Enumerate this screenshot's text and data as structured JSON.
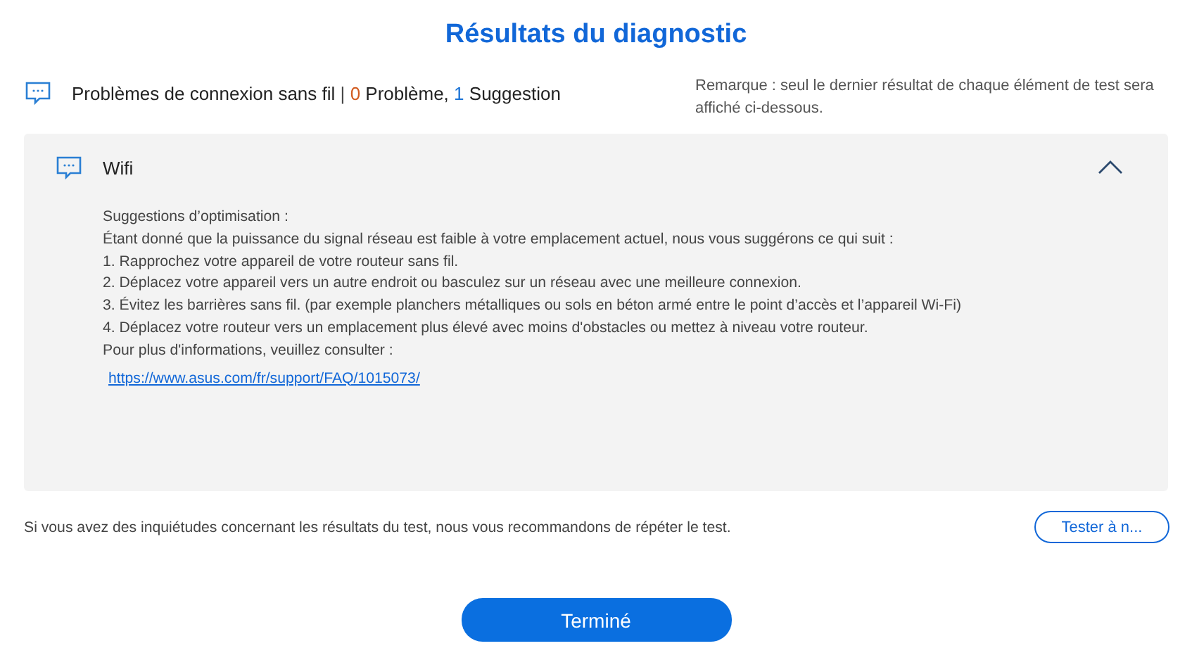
{
  "title": "Résultats du diagnostic",
  "category": {
    "name": "Problèmes de connexion sans fil",
    "separator": "|",
    "problem_count": "0",
    "problem_label": "Problème,",
    "suggestion_count": "1",
    "suggestion_label": "Suggestion"
  },
  "note": "Remarque : seul le dernier résultat de chaque élément de test sera affiché ci-dessous.",
  "panel": {
    "title": "Wifi",
    "expanded": true,
    "lines": [
      "Suggestions d’optimisation :",
      "Étant donné que la puissance du signal réseau est faible à votre emplacement actuel, nous vous suggérons ce qui suit :",
      "1. Rapprochez votre appareil de votre routeur sans fil.",
      "2. Déplacez votre appareil vers un autre endroit ou basculez sur un réseau avec une meilleure connexion.",
      "3. Évitez les barrières sans fil. (par exemple planchers métalliques ou sols en béton armé entre le point d’accès et l’appareil Wi-Fi)",
      "4. Déplacez votre routeur vers un emplacement plus élevé avec moins d'obstacles ou mettez à niveau votre routeur.",
      "Pour plus d'informations, veuillez consulter :"
    ],
    "link": "https://www.asus.com/fr/support/FAQ/1015073/"
  },
  "retest_text": "Si vous avez des inquiétudes concernant les résultats du test, nous vous recommandons de répéter le test.",
  "retest_button": "Tester à n...",
  "done_button": "Terminé"
}
